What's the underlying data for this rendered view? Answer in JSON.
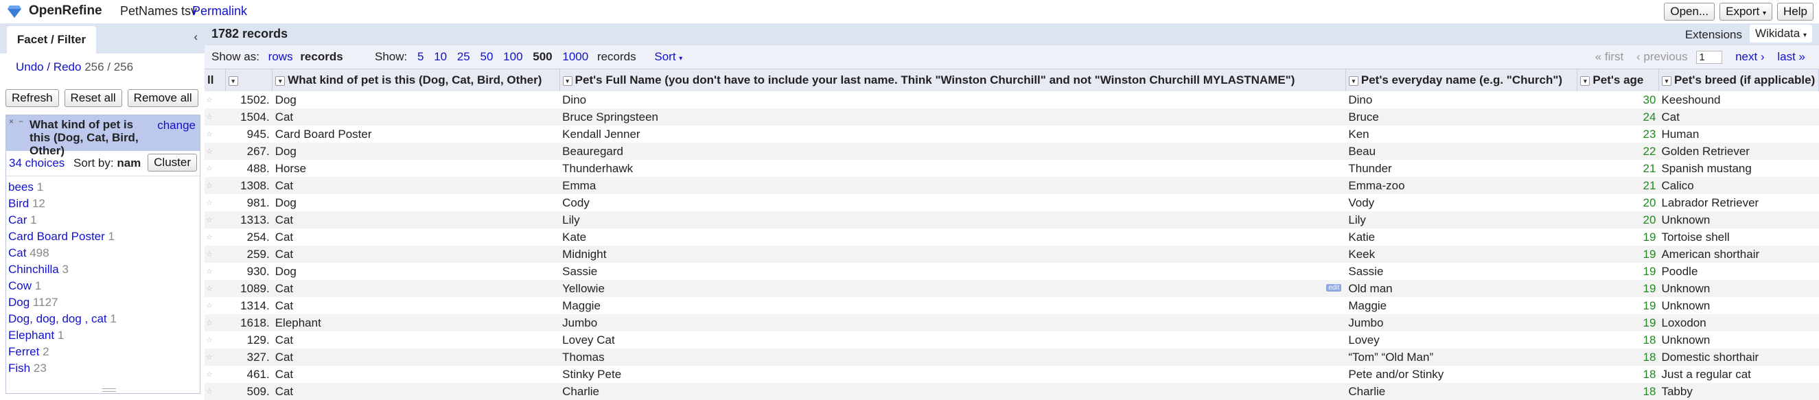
{
  "app": {
    "brand": "OpenRefine",
    "project_name": "PetNames tsv",
    "permalink": "Permalink"
  },
  "header_buttons": {
    "open": "Open...",
    "export": "Export",
    "help": "Help"
  },
  "left_panel": {
    "tab": "Facet / Filter",
    "undo_label": "Undo / Redo",
    "undo_count": "256 / 256",
    "refresh": "Refresh",
    "reset_all": "Reset all",
    "remove_all": "Remove all",
    "facet": {
      "title": "What kind of pet is this (Dog, Cat, Bird, Other)",
      "change": "change",
      "choices": "34 choices",
      "sort_by": "Sort by:",
      "sort_value": "nam",
      "cluster": "Cluster",
      "items": [
        {
          "label": "bees",
          "count": "1"
        },
        {
          "label": "Bird",
          "count": "12"
        },
        {
          "label": "Car",
          "count": "1"
        },
        {
          "label": "Card Board Poster",
          "count": "1"
        },
        {
          "label": "Cat",
          "count": "498"
        },
        {
          "label": "Chinchilla",
          "count": "3"
        },
        {
          "label": "Cow",
          "count": "1"
        },
        {
          "label": "Dog",
          "count": "1127"
        },
        {
          "label": "Dog, dog, dog , cat",
          "count": "1"
        },
        {
          "label": "Elephant",
          "count": "1"
        },
        {
          "label": "Ferret",
          "count": "2"
        },
        {
          "label": "Fish",
          "count": "23"
        }
      ]
    }
  },
  "grid": {
    "records": "1782 records",
    "extensions": "Extensions",
    "wikidata": "Wikidata",
    "show_as": "Show as:",
    "rows": "rows",
    "records_mode": "records",
    "show": "Show:",
    "page_sizes": [
      "5",
      "10",
      "25",
      "50",
      "100"
    ],
    "page_size_selected": "500",
    "page_size_1000": "1000",
    "records_word": "records",
    "sort": "Sort",
    "first": "« first",
    "previous": "‹ previous",
    "page": "1",
    "next": "next ›",
    "last": "last »",
    "columns": {
      "all": "ll",
      "kind": "What kind of pet is this (Dog, Cat, Bird, Other)",
      "full_name": "Pet's Full Name (you don't have to include your last name. Think \"Winston Churchill\" and not \"Winston Churchill MYLASTNAME\")",
      "everyday": "Pet's everyday name (e.g. \"Church\")",
      "age": "Pet's age",
      "breed": "Pet's breed (if applicable)"
    },
    "edit_label": "edit",
    "rows_data": [
      {
        "idx": "1502.",
        "kind": "Dog",
        "full": "Dino",
        "everyday": "Dino",
        "age": "30",
        "breed": "Keeshound"
      },
      {
        "idx": "1504.",
        "kind": "Cat",
        "full": "Bruce Springsteen",
        "everyday": "Bruce",
        "age": "24",
        "breed": "Cat"
      },
      {
        "idx": "945.",
        "kind": "Card Board Poster",
        "full": "Kendall Jenner",
        "everyday": "Ken",
        "age": "23",
        "breed": "Human"
      },
      {
        "idx": "267.",
        "kind": "Dog",
        "full": "Beauregard",
        "everyday": "Beau",
        "age": "22",
        "breed": "Golden Retriever"
      },
      {
        "idx": "488.",
        "kind": "Horse",
        "full": "Thunderhawk",
        "everyday": "Thunder",
        "age": "21",
        "breed": "Spanish mustang"
      },
      {
        "idx": "1308.",
        "kind": "Cat",
        "full": "Emma",
        "everyday": "Emma-zoo",
        "age": "21",
        "breed": "Calico"
      },
      {
        "idx": "981.",
        "kind": "Dog",
        "full": "Cody",
        "everyday": "Vody",
        "age": "20",
        "breed": "Labrador Retriever"
      },
      {
        "idx": "1313.",
        "kind": "Cat",
        "full": "Lily",
        "everyday": "Lily",
        "age": "20",
        "breed": "Unknown"
      },
      {
        "idx": "254.",
        "kind": "Cat",
        "full": "Kate",
        "everyday": "Katie",
        "age": "19",
        "breed": "Tortoise shell"
      },
      {
        "idx": "259.",
        "kind": "Cat",
        "full": "Midnight",
        "everyday": "Keek",
        "age": "19",
        "breed": "American shorthair"
      },
      {
        "idx": "930.",
        "kind": "Dog",
        "full": "Sassie",
        "everyday": "Sassie",
        "age": "19",
        "breed": "Poodle"
      },
      {
        "idx": "1089.",
        "kind": "Cat",
        "full": "Yellowie",
        "everyday": "Old man",
        "age": "19",
        "breed": "Unknown"
      },
      {
        "idx": "1314.",
        "kind": "Cat",
        "full": "Maggie",
        "everyday": "Maggie",
        "age": "19",
        "breed": "Unknown"
      },
      {
        "idx": "1618.",
        "kind": "Elephant",
        "full": "Jumbo",
        "everyday": "Jumbo",
        "age": "19",
        "breed": "Loxodon"
      },
      {
        "idx": "129.",
        "kind": "Cat",
        "full": "Lovey Cat",
        "everyday": "Lovey",
        "age": "18",
        "breed": "Unknown"
      },
      {
        "idx": "327.",
        "kind": "Cat",
        "full": "Thomas",
        "everyday": "“Tom” “Old Man”",
        "age": "18",
        "breed": "Domestic shorthair"
      },
      {
        "idx": "461.",
        "kind": "Cat",
        "full": "Stinky Pete",
        "everyday": "Pete and/or Stinky",
        "age": "18",
        "breed": "Just a regular cat"
      },
      {
        "idx": "509.",
        "kind": "Cat",
        "full": "Charlie",
        "everyday": "Charlie",
        "age": "18",
        "breed": "Tabby"
      }
    ]
  }
}
